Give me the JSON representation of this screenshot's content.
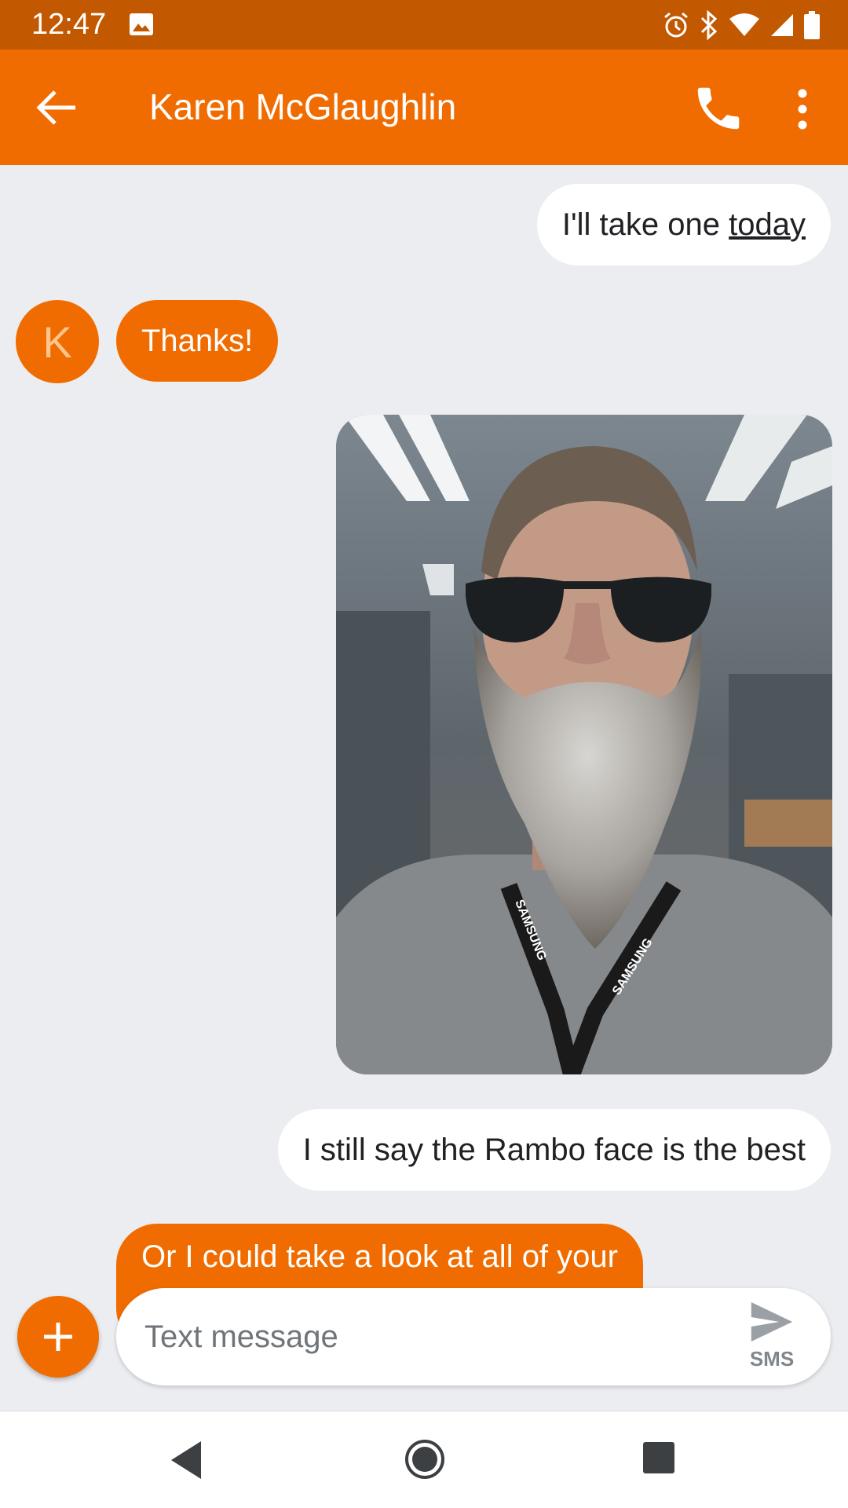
{
  "status_bar": {
    "time": "12:47",
    "icons": [
      "gallery-icon",
      "alarm-icon",
      "bluetooth-icon",
      "wifi-icon",
      "signal-icon",
      "battery-icon"
    ]
  },
  "app_bar": {
    "contact_name": "Karen McGlaughlin",
    "background_color": "#f06c00",
    "icons": [
      "back-arrow-icon",
      "phone-icon",
      "more-vert-icon"
    ]
  },
  "conversation": {
    "messages": [
      {
        "direction": "outgoing",
        "text_before_link": "I'll take one ",
        "link_text": "today"
      },
      {
        "direction": "incoming",
        "avatar_letter": "K",
        "text": "Thanks!"
      },
      {
        "direction": "outgoing",
        "type": "image",
        "description_icon": "photo"
      },
      {
        "direction": "outgoing",
        "text": "I still say the Rambo face is the best"
      },
      {
        "direction": "incoming",
        "text": "Or I could take a look at all of your"
      }
    ],
    "image_lanyard_text": [
      "SAMSUNG",
      "SAMSUNG"
    ]
  },
  "compose": {
    "placeholder": "Text message",
    "send_label": "SMS",
    "icons": [
      "add-icon",
      "send-icon"
    ]
  },
  "colors": {
    "accent": "#f06c00",
    "status_bar": "#c25800",
    "background": "#ebedf0",
    "outgoing_bubble": "#ffffff"
  }
}
